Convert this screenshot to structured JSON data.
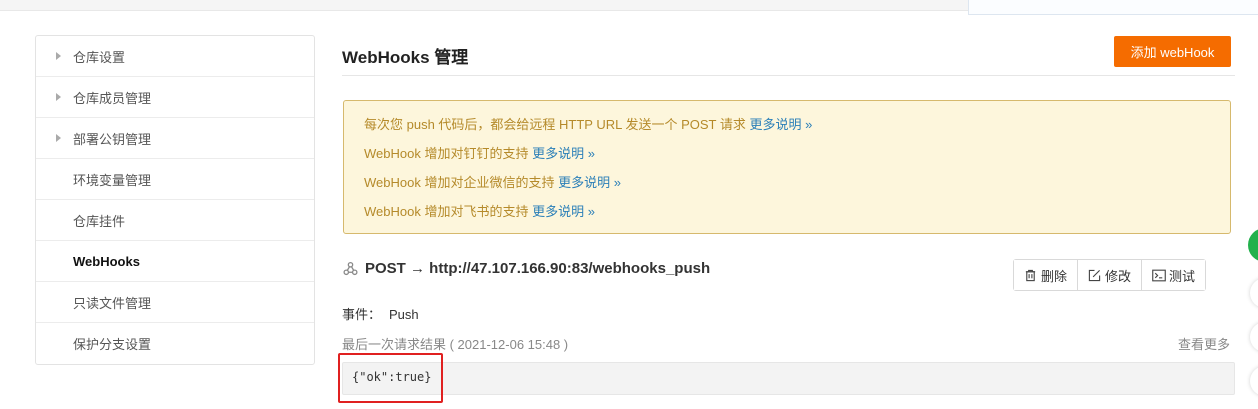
{
  "sidebar": {
    "items": [
      {
        "label": "仓库设置",
        "has_caret": true
      },
      {
        "label": "仓库成员管理",
        "has_caret": true
      },
      {
        "label": "部署公钥管理",
        "has_caret": true
      },
      {
        "label": "环境变量管理",
        "has_caret": false
      },
      {
        "label": "仓库挂件",
        "has_caret": false
      },
      {
        "label": "WebHooks",
        "has_caret": false,
        "active": true
      },
      {
        "label": "只读文件管理",
        "has_caret": false
      },
      {
        "label": "保护分支设置",
        "has_caret": false
      }
    ]
  },
  "main": {
    "title": "WebHooks 管理",
    "add_button": "添加 webHook",
    "notice": {
      "lines": [
        {
          "text": "每次您 push 代码后，都会给远程 HTTP URL 发送一个 POST 请求",
          "link": "更多说明 »"
        },
        {
          "text": "WebHook 增加对钉钉的支持",
          "link": "更多说明 »"
        },
        {
          "text": "WebHook 增加对企业微信的支持",
          "link": "更多说明 »"
        },
        {
          "text": "WebHook 增加对飞书的支持",
          "link": "更多说明 »"
        }
      ]
    },
    "hook": {
      "url": "POST → http://47.107.166.90:83/webhooks_push",
      "actions": {
        "delete": "删除",
        "edit": "修改",
        "test": "测试"
      },
      "event_label": "事件：",
      "event_value": "Push",
      "last_result_label": "最后一次请求结果 ( 2021-12-06 15:48 )",
      "see_more": "查看更多",
      "result": "{\"ok\":true}"
    }
  },
  "colors": {
    "accent": "#f56c00",
    "notice_bg": "#fdf6dc",
    "notice_text": "#b58a2a",
    "link": "#2a7fb8",
    "highlight": "#e02020"
  },
  "icons": [
    "webhook-icon",
    "trash-icon",
    "edit-icon",
    "terminal-icon",
    "caret-right-icon"
  ]
}
